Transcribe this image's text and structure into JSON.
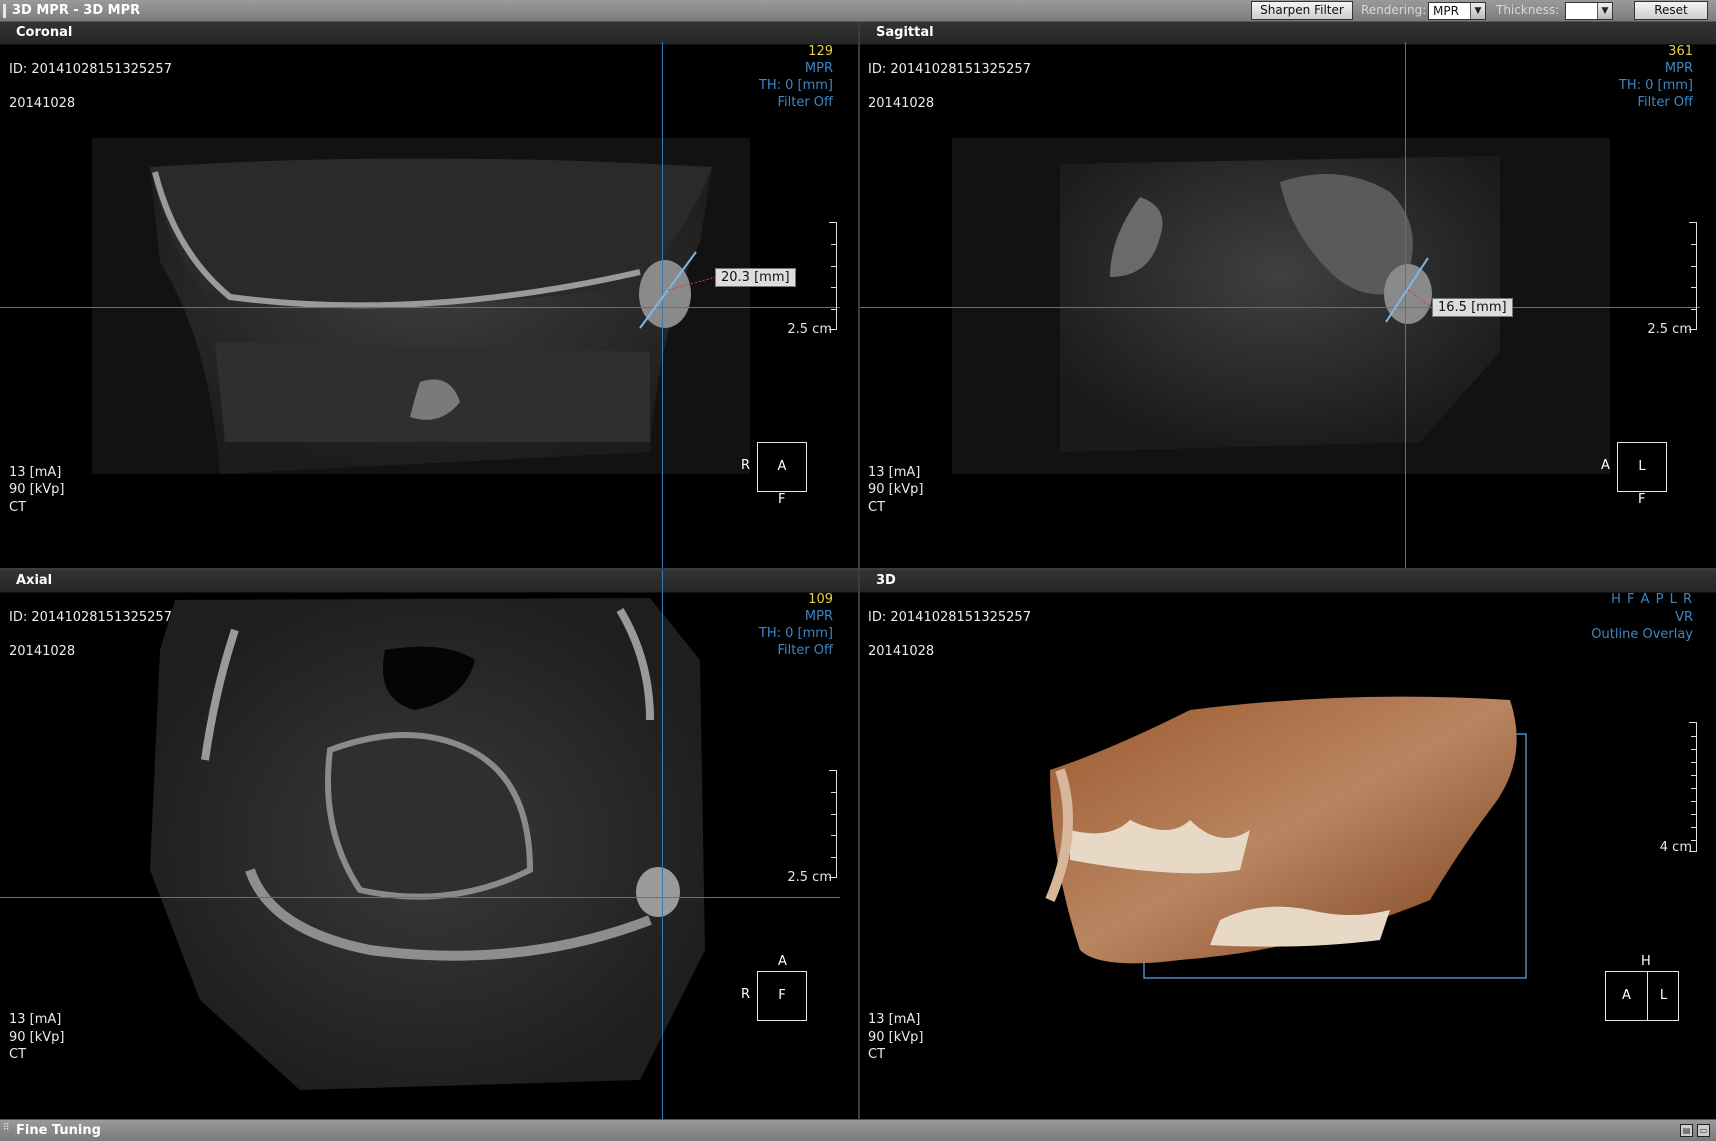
{
  "titlebar": {
    "title": "3D MPR - 3D MPR",
    "sharpen_label": "Sharpen Filter",
    "rendering_label": "Rendering:",
    "rendering_value": "MPR",
    "thickness_label": "Thickness:",
    "thickness_value": "",
    "reset_label": "Reset"
  },
  "viewports": {
    "coronal": {
      "title": "Coronal",
      "id": "ID: 20141028151325257",
      "date": "20141028",
      "slice": "129",
      "mode": "MPR",
      "th": "TH: 0 [mm]",
      "filter": "Filter Off",
      "scale": "2.5 cm",
      "ma": "13 [mA]",
      "kvp": "90 [kVp]",
      "modality": "CT",
      "orient_center": "A",
      "orient_left": "R",
      "orient_bottom": "F",
      "measurement": "20.3 [mm]"
    },
    "sagittal": {
      "title": "Sagittal",
      "id": "ID: 20141028151325257",
      "date": "20141028",
      "slice": "361",
      "mode": "MPR",
      "th": "TH: 0 [mm]",
      "filter": "Filter Off",
      "scale": "2.5 cm",
      "ma": "13 [mA]",
      "kvp": "90 [kVp]",
      "modality": "CT",
      "orient_center": "L",
      "orient_left": "A",
      "orient_bottom": "F",
      "measurement": "16.5 [mm]"
    },
    "axial": {
      "title": "Axial",
      "id": "ID: 20141028151325257",
      "date": "20141028",
      "slice": "109",
      "mode": "MPR",
      "th": "TH: 0 [mm]",
      "filter": "Filter Off",
      "scale": "2.5 cm",
      "ma": "13 [mA]",
      "kvp": "90 [kVp]",
      "modality": "CT",
      "orient_center": "F",
      "orient_left": "R",
      "orient_top": "A"
    },
    "threed": {
      "title": "3D",
      "id": "ID: 20141028151325257",
      "date": "20141028",
      "directions": "H F A P L R",
      "mode": "VR",
      "overlay": "Outline Overlay",
      "scale": "4 cm",
      "ma": "13 [mA]",
      "kvp": "90 [kVp]",
      "modality": "CT",
      "orient_top": "H",
      "orient_a": "A",
      "orient_l": "L"
    }
  },
  "bottombar": {
    "label": "Fine Tuning"
  },
  "colors": {
    "crosshair": "#3a7bb4",
    "overlay_blue": "#3f86c2",
    "slice_yellow": "#e6d23c"
  }
}
